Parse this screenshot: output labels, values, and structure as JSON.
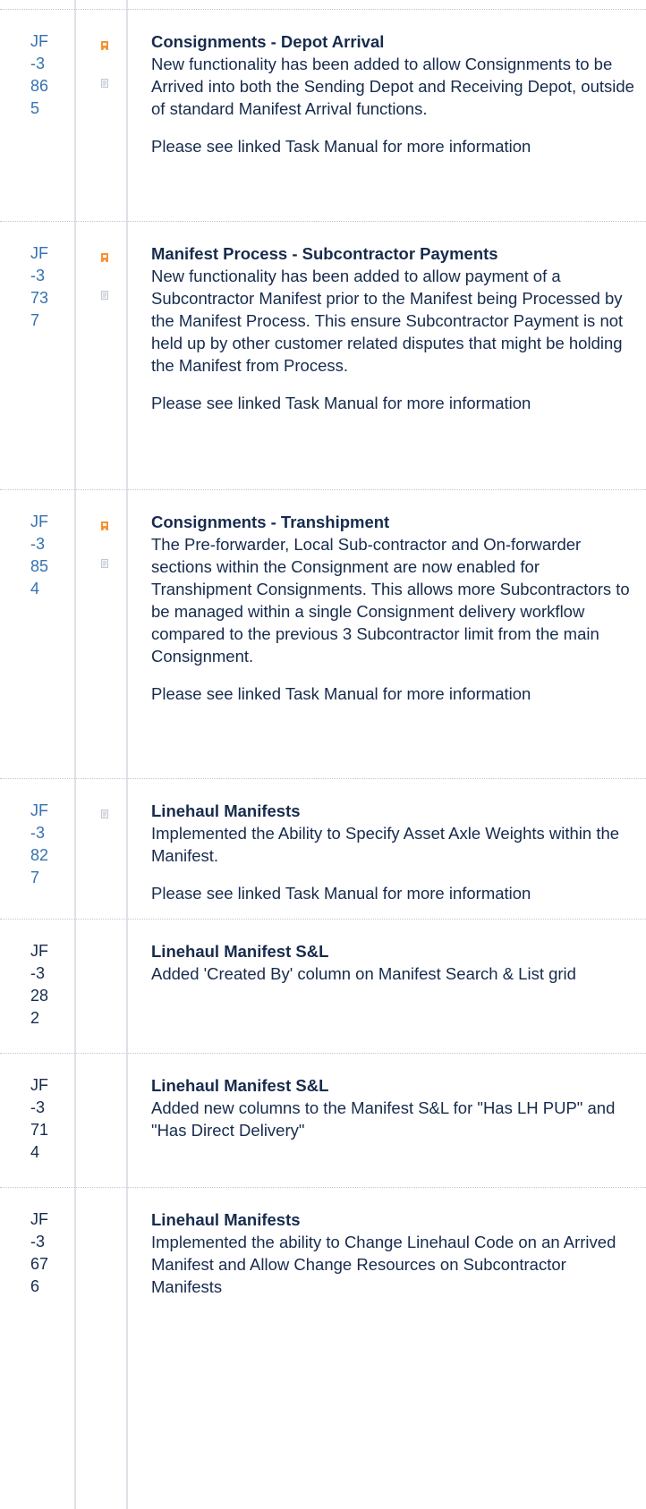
{
  "rows": [
    {
      "key_lines": [
        "JF",
        "-3",
        "86",
        "5"
      ],
      "key_is_link": true,
      "icons": [
        "bookmark-icon",
        "document-icon"
      ],
      "title": "Consignments - Depot Arrival",
      "description": "New functionality has been added to allow Consignments to be Arrived into both the Sending Depot and Receiving Depot, outside of standard Manifest Arrival functions.",
      "note": "Please see linked Task Manual for more information"
    },
    {
      "key_lines": [
        "JF",
        "-3",
        "73",
        "7"
      ],
      "key_is_link": true,
      "icons": [
        "bookmark-icon",
        "document-icon"
      ],
      "title": "Manifest Process - Subcontractor Payments",
      "description": "New functionality has been added to allow payment of a Subcontractor Manifest prior to the Manifest being Processed by the Manifest Process.  This ensure Subcontractor Payment is not held up by other customer related disputes that might be holding the Manifest from Process.",
      "note": "Please see linked Task Manual for more information"
    },
    {
      "key_lines": [
        "JF",
        "-3",
        "85",
        "4"
      ],
      "key_is_link": true,
      "icons": [
        "bookmark-icon",
        "document-icon"
      ],
      "title": "Consignments - Transhipment",
      "description": "The Pre-forwarder, Local Sub-contractor and On-forwarder sections within the Consignment are now enabled for Transhipment Consignments.   This allows more Subcontractors to be managed within a single Consignment delivery workflow compared to the previous 3 Subcontractor limit from the main Consignment.",
      "note": "Please see linked Task Manual for more information"
    },
    {
      "key_lines": [
        "JF",
        "-3",
        "82",
        "7"
      ],
      "key_is_link": true,
      "icons": [
        "document-icon"
      ],
      "title": "Linehaul Manifests",
      "description": "Implemented the Ability to Specify Asset Axle Weights within the Manifest.",
      "note": "Please see linked Task Manual for more information"
    },
    {
      "key_lines": [
        "JF",
        "-3",
        "28",
        "2"
      ],
      "key_is_link": false,
      "icons": [],
      "title": "Linehaul Manifest S&L",
      "description": "Added 'Created By' column on Manifest Search & List grid",
      "note": ""
    },
    {
      "key_lines": [
        "JF",
        "-3",
        "71",
        "4"
      ],
      "key_is_link": false,
      "icons": [],
      "title": "Linehaul Manifest S&L",
      "description": "Added new columns to the Manifest S&L for \"Has LH PUP\" and \"Has Direct Delivery\"",
      "note": ""
    },
    {
      "key_lines": [
        "JF",
        "-3",
        "67",
        "6"
      ],
      "key_is_link": false,
      "icons": [],
      "title": "Linehaul Manifests",
      "description": "Implemented the ability to Change Linehaul Code on an Arrived Manifest and Allow Change Resources on Subcontractor Manifests",
      "note": ""
    }
  ],
  "colors": {
    "link": "#3572b0",
    "bookmark_icon": "#f79232",
    "document_icon": "#c1c7d0"
  }
}
